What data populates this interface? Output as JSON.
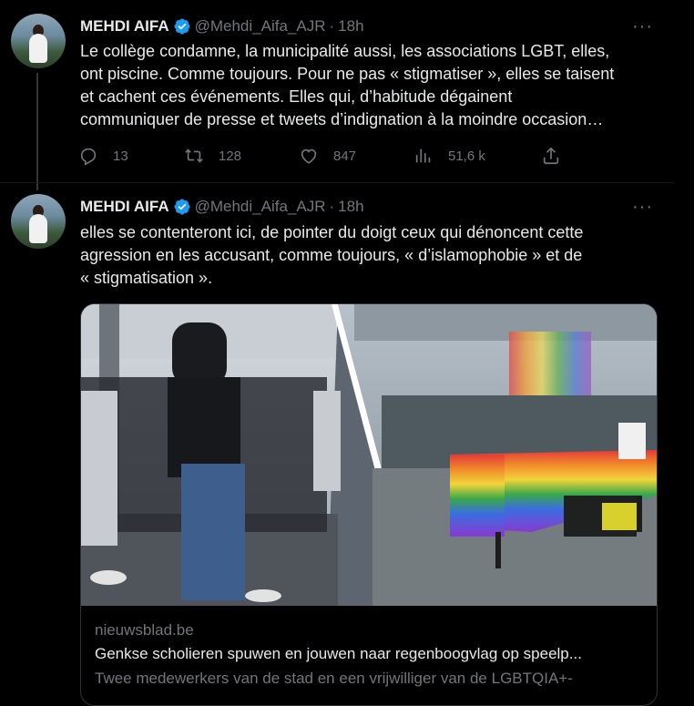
{
  "tweets": [
    {
      "name": "MEHDI AIFA",
      "handle": "@Mehdi_Aifa_AJR",
      "time": "18h",
      "more": "···",
      "text": "Le collège condamne, la municipalité aussi, les associations LGBT, elles,\nont piscine. Comme toujours. Pour ne pas « stigmatiser », elles se taisent\net cachent ces événements. Elles qui, d’habitude dégainent\ncommuniquer de presse et tweets d’indignation à la moindre occasion…",
      "actions": {
        "replies": "13",
        "retweets": "128",
        "likes": "847",
        "views": "51,6 k"
      }
    },
    {
      "name": "MEHDI AIFA",
      "handle": "@Mehdi_Aifa_AJR",
      "time": "18h",
      "more": "···",
      "text": "elles se contenteront ici, de pointer du doigt ceux qui dénoncent cette\nagression en les accusant, comme toujours, « d’islamophobie » et de\n« stigmatisation ».",
      "card": {
        "domain": "nieuwsblad.be",
        "title": "Genkse scholieren spuwen en jouwen naar regenboogvlag op speelp...",
        "description": "Twee medewerkers van de stad en een vrijwilliger van de LGBTQIA+-"
      }
    }
  ],
  "colors": {
    "background": "#000000",
    "text": "#e7e9ea",
    "muted": "#71767b",
    "verified": "#1d9bf0",
    "border": "#2f3336"
  }
}
